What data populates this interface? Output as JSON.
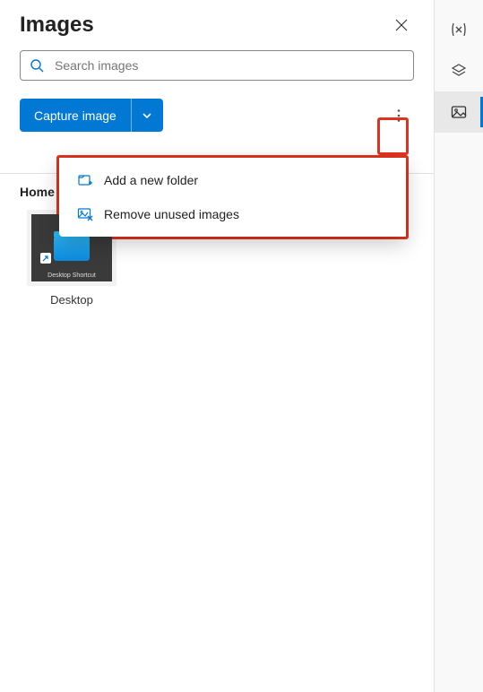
{
  "header": {
    "title": "Images"
  },
  "search": {
    "placeholder": "Search images"
  },
  "toolbar": {
    "capture_label": "Capture image"
  },
  "menu": {
    "items": [
      {
        "icon": "folder-add-icon",
        "label": "Add a new folder"
      },
      {
        "icon": "image-remove-icon",
        "label": "Remove unused images"
      }
    ]
  },
  "breadcrumb": "Home",
  "thumbs": [
    {
      "label": "Desktop",
      "caption": "Desktop\nShortcut"
    }
  ],
  "rail": {
    "items": [
      "variables",
      "layers",
      "images"
    ]
  },
  "colors": {
    "accent": "#0078d4",
    "highlight": "#e0331f"
  }
}
